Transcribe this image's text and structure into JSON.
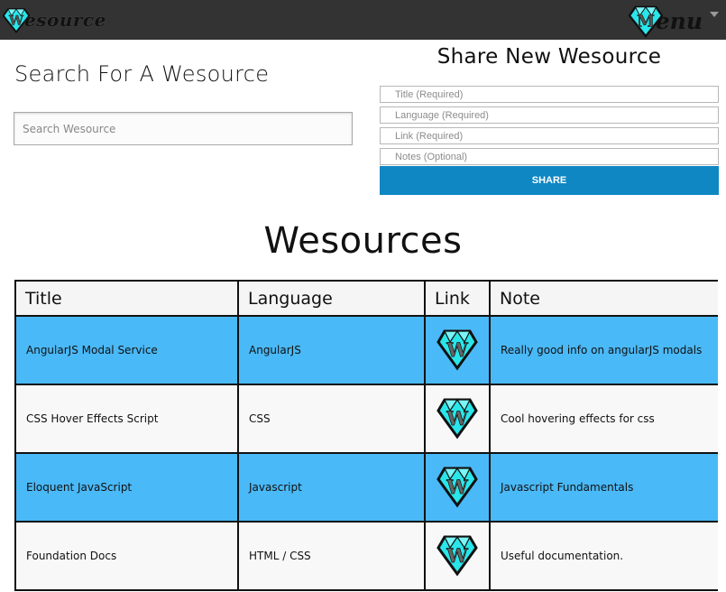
{
  "header": {
    "logo_letter": "W",
    "logo_text": "esource",
    "menu_letter": "M",
    "menu_text": "enu"
  },
  "search": {
    "title": "Search For A Wesource",
    "placeholder": "Search Wesource"
  },
  "share": {
    "title": "Share New Wesource",
    "title_placeholder": "Title (Required)",
    "language_placeholder": "Language (Required)",
    "link_placeholder": "Link (Required)",
    "notes_placeholder": "Notes (Optional)",
    "button_label": "SHARE"
  },
  "main": {
    "heading": "Wesources"
  },
  "table": {
    "columns": [
      "Title",
      "Language",
      "Link",
      "Note"
    ],
    "rows": [
      {
        "title": "AngularJS Modal Service",
        "language": "AngularJS",
        "link_icon": "W",
        "note": "Really good info on angularJS modals",
        "highlight": true
      },
      {
        "title": "CSS Hover Effects Script",
        "language": "CSS",
        "link_icon": "W",
        "note": "Cool hovering effects for css",
        "highlight": false
      },
      {
        "title": "Eloquent JavaScript",
        "language": "Javascript",
        "link_icon": "W",
        "note": "Javascript Fundamentals",
        "highlight": true
      },
      {
        "title": "Foundation Docs",
        "language": "HTML / CSS",
        "link_icon": "W",
        "note": "Useful documentation.",
        "highlight": false
      }
    ]
  },
  "colors": {
    "topbar": "#333333",
    "row_highlight": "#4ab9f7",
    "button": "#0f87c3",
    "gem": "#29e6ea"
  }
}
